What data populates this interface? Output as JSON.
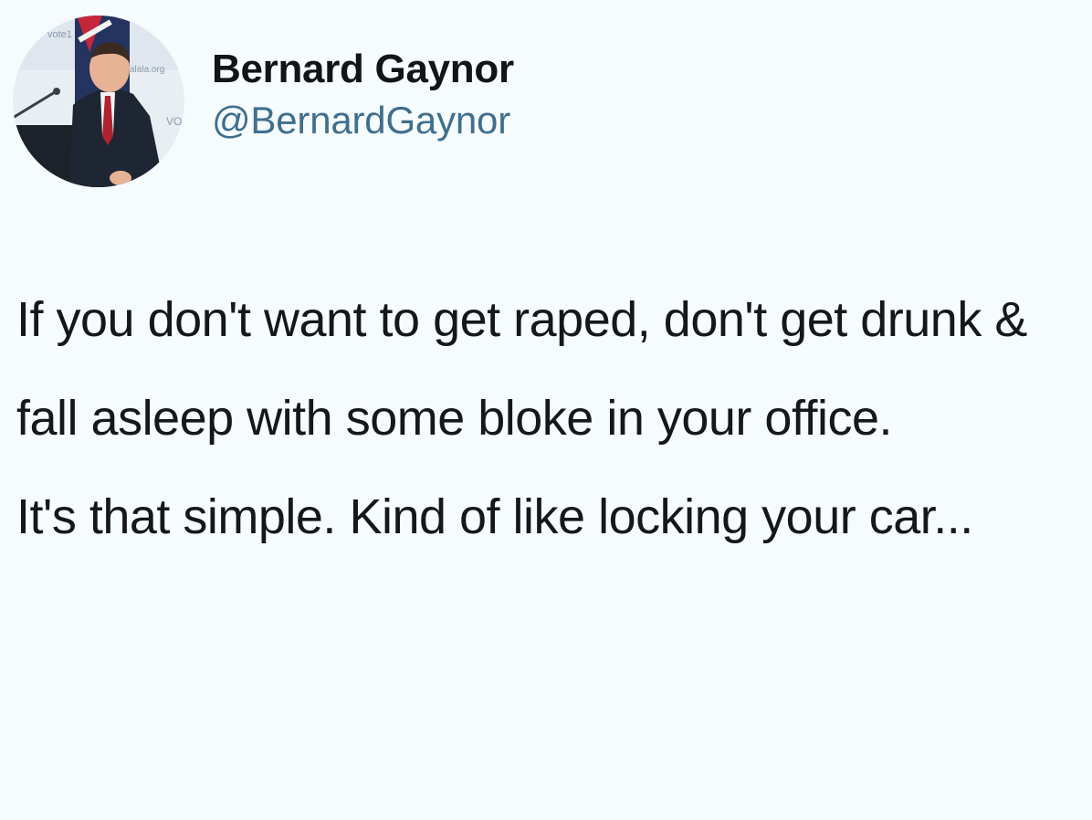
{
  "tweet": {
    "author": {
      "display_name": "Bernard Gaynor",
      "handle": "@BernardGaynor",
      "avatar_icon": "profile-photo",
      "avatar_backdrop_text": "vote1, alala.org, VO"
    },
    "text": {
      "paragraph_1": "If you don't want to get raped, don't get drunk & fall asleep with some bloke in your office.",
      "paragraph_2": "It's that simple. Kind of like locking your car..."
    }
  },
  "colors": {
    "background": "#f6fbfd",
    "name_text": "#111418",
    "handle_text": "#3f6f8f",
    "body_text": "#151719"
  }
}
